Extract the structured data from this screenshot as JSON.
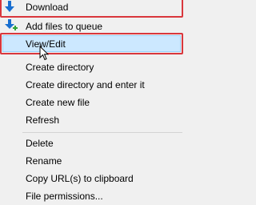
{
  "menu": {
    "items": [
      {
        "label": "Download",
        "icon": "download-arrow-icon"
      },
      {
        "label": "Add files to queue",
        "icon": "add-to-queue-icon"
      },
      {
        "label": "View/Edit"
      },
      {
        "label": "Create directory"
      },
      {
        "label": "Create directory and enter it"
      },
      {
        "label": "Create new file"
      },
      {
        "label": "Refresh"
      },
      {
        "label": "Delete"
      },
      {
        "label": "Rename"
      },
      {
        "label": "Copy URL(s) to clipboard"
      },
      {
        "label": "File permissions..."
      }
    ],
    "highlight_color": "#cce8ff",
    "annotation_color": "#d9373d"
  }
}
